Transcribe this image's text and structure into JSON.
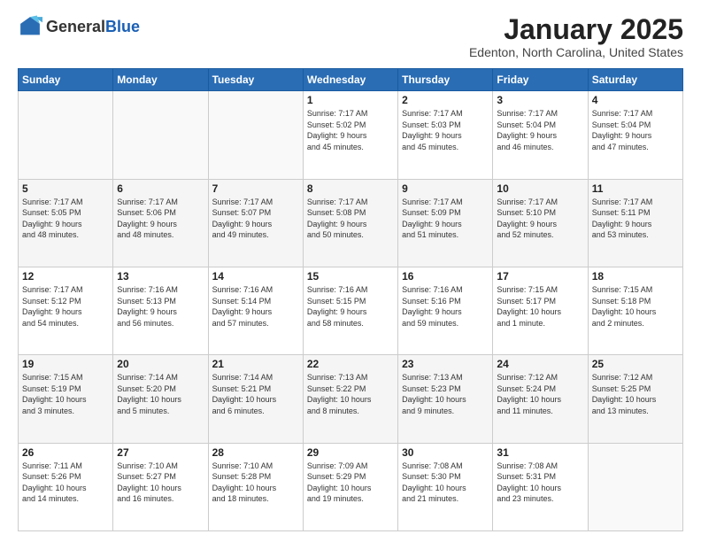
{
  "header": {
    "logo": {
      "general": "General",
      "blue": "Blue"
    },
    "title": "January 2025",
    "location": "Edenton, North Carolina, United States"
  },
  "calendar": {
    "days_of_week": [
      "Sunday",
      "Monday",
      "Tuesday",
      "Wednesday",
      "Thursday",
      "Friday",
      "Saturday"
    ],
    "weeks": [
      {
        "days": [
          {
            "num": "",
            "info": ""
          },
          {
            "num": "",
            "info": ""
          },
          {
            "num": "",
            "info": ""
          },
          {
            "num": "1",
            "info": "Sunrise: 7:17 AM\nSunset: 5:02 PM\nDaylight: 9 hours\nand 45 minutes."
          },
          {
            "num": "2",
            "info": "Sunrise: 7:17 AM\nSunset: 5:03 PM\nDaylight: 9 hours\nand 45 minutes."
          },
          {
            "num": "3",
            "info": "Sunrise: 7:17 AM\nSunset: 5:04 PM\nDaylight: 9 hours\nand 46 minutes."
          },
          {
            "num": "4",
            "info": "Sunrise: 7:17 AM\nSunset: 5:04 PM\nDaylight: 9 hours\nand 47 minutes."
          }
        ]
      },
      {
        "days": [
          {
            "num": "5",
            "info": "Sunrise: 7:17 AM\nSunset: 5:05 PM\nDaylight: 9 hours\nand 48 minutes."
          },
          {
            "num": "6",
            "info": "Sunrise: 7:17 AM\nSunset: 5:06 PM\nDaylight: 9 hours\nand 48 minutes."
          },
          {
            "num": "7",
            "info": "Sunrise: 7:17 AM\nSunset: 5:07 PM\nDaylight: 9 hours\nand 49 minutes."
          },
          {
            "num": "8",
            "info": "Sunrise: 7:17 AM\nSunset: 5:08 PM\nDaylight: 9 hours\nand 50 minutes."
          },
          {
            "num": "9",
            "info": "Sunrise: 7:17 AM\nSunset: 5:09 PM\nDaylight: 9 hours\nand 51 minutes."
          },
          {
            "num": "10",
            "info": "Sunrise: 7:17 AM\nSunset: 5:10 PM\nDaylight: 9 hours\nand 52 minutes."
          },
          {
            "num": "11",
            "info": "Sunrise: 7:17 AM\nSunset: 5:11 PM\nDaylight: 9 hours\nand 53 minutes."
          }
        ]
      },
      {
        "days": [
          {
            "num": "12",
            "info": "Sunrise: 7:17 AM\nSunset: 5:12 PM\nDaylight: 9 hours\nand 54 minutes."
          },
          {
            "num": "13",
            "info": "Sunrise: 7:16 AM\nSunset: 5:13 PM\nDaylight: 9 hours\nand 56 minutes."
          },
          {
            "num": "14",
            "info": "Sunrise: 7:16 AM\nSunset: 5:14 PM\nDaylight: 9 hours\nand 57 minutes."
          },
          {
            "num": "15",
            "info": "Sunrise: 7:16 AM\nSunset: 5:15 PM\nDaylight: 9 hours\nand 58 minutes."
          },
          {
            "num": "16",
            "info": "Sunrise: 7:16 AM\nSunset: 5:16 PM\nDaylight: 9 hours\nand 59 minutes."
          },
          {
            "num": "17",
            "info": "Sunrise: 7:15 AM\nSunset: 5:17 PM\nDaylight: 10 hours\nand 1 minute."
          },
          {
            "num": "18",
            "info": "Sunrise: 7:15 AM\nSunset: 5:18 PM\nDaylight: 10 hours\nand 2 minutes."
          }
        ]
      },
      {
        "days": [
          {
            "num": "19",
            "info": "Sunrise: 7:15 AM\nSunset: 5:19 PM\nDaylight: 10 hours\nand 3 minutes."
          },
          {
            "num": "20",
            "info": "Sunrise: 7:14 AM\nSunset: 5:20 PM\nDaylight: 10 hours\nand 5 minutes."
          },
          {
            "num": "21",
            "info": "Sunrise: 7:14 AM\nSunset: 5:21 PM\nDaylight: 10 hours\nand 6 minutes."
          },
          {
            "num": "22",
            "info": "Sunrise: 7:13 AM\nSunset: 5:22 PM\nDaylight: 10 hours\nand 8 minutes."
          },
          {
            "num": "23",
            "info": "Sunrise: 7:13 AM\nSunset: 5:23 PM\nDaylight: 10 hours\nand 9 minutes."
          },
          {
            "num": "24",
            "info": "Sunrise: 7:12 AM\nSunset: 5:24 PM\nDaylight: 10 hours\nand 11 minutes."
          },
          {
            "num": "25",
            "info": "Sunrise: 7:12 AM\nSunset: 5:25 PM\nDaylight: 10 hours\nand 13 minutes."
          }
        ]
      },
      {
        "days": [
          {
            "num": "26",
            "info": "Sunrise: 7:11 AM\nSunset: 5:26 PM\nDaylight: 10 hours\nand 14 minutes."
          },
          {
            "num": "27",
            "info": "Sunrise: 7:10 AM\nSunset: 5:27 PM\nDaylight: 10 hours\nand 16 minutes."
          },
          {
            "num": "28",
            "info": "Sunrise: 7:10 AM\nSunset: 5:28 PM\nDaylight: 10 hours\nand 18 minutes."
          },
          {
            "num": "29",
            "info": "Sunrise: 7:09 AM\nSunset: 5:29 PM\nDaylight: 10 hours\nand 19 minutes."
          },
          {
            "num": "30",
            "info": "Sunrise: 7:08 AM\nSunset: 5:30 PM\nDaylight: 10 hours\nand 21 minutes."
          },
          {
            "num": "31",
            "info": "Sunrise: 7:08 AM\nSunset: 5:31 PM\nDaylight: 10 hours\nand 23 minutes."
          },
          {
            "num": "",
            "info": ""
          }
        ]
      }
    ]
  }
}
